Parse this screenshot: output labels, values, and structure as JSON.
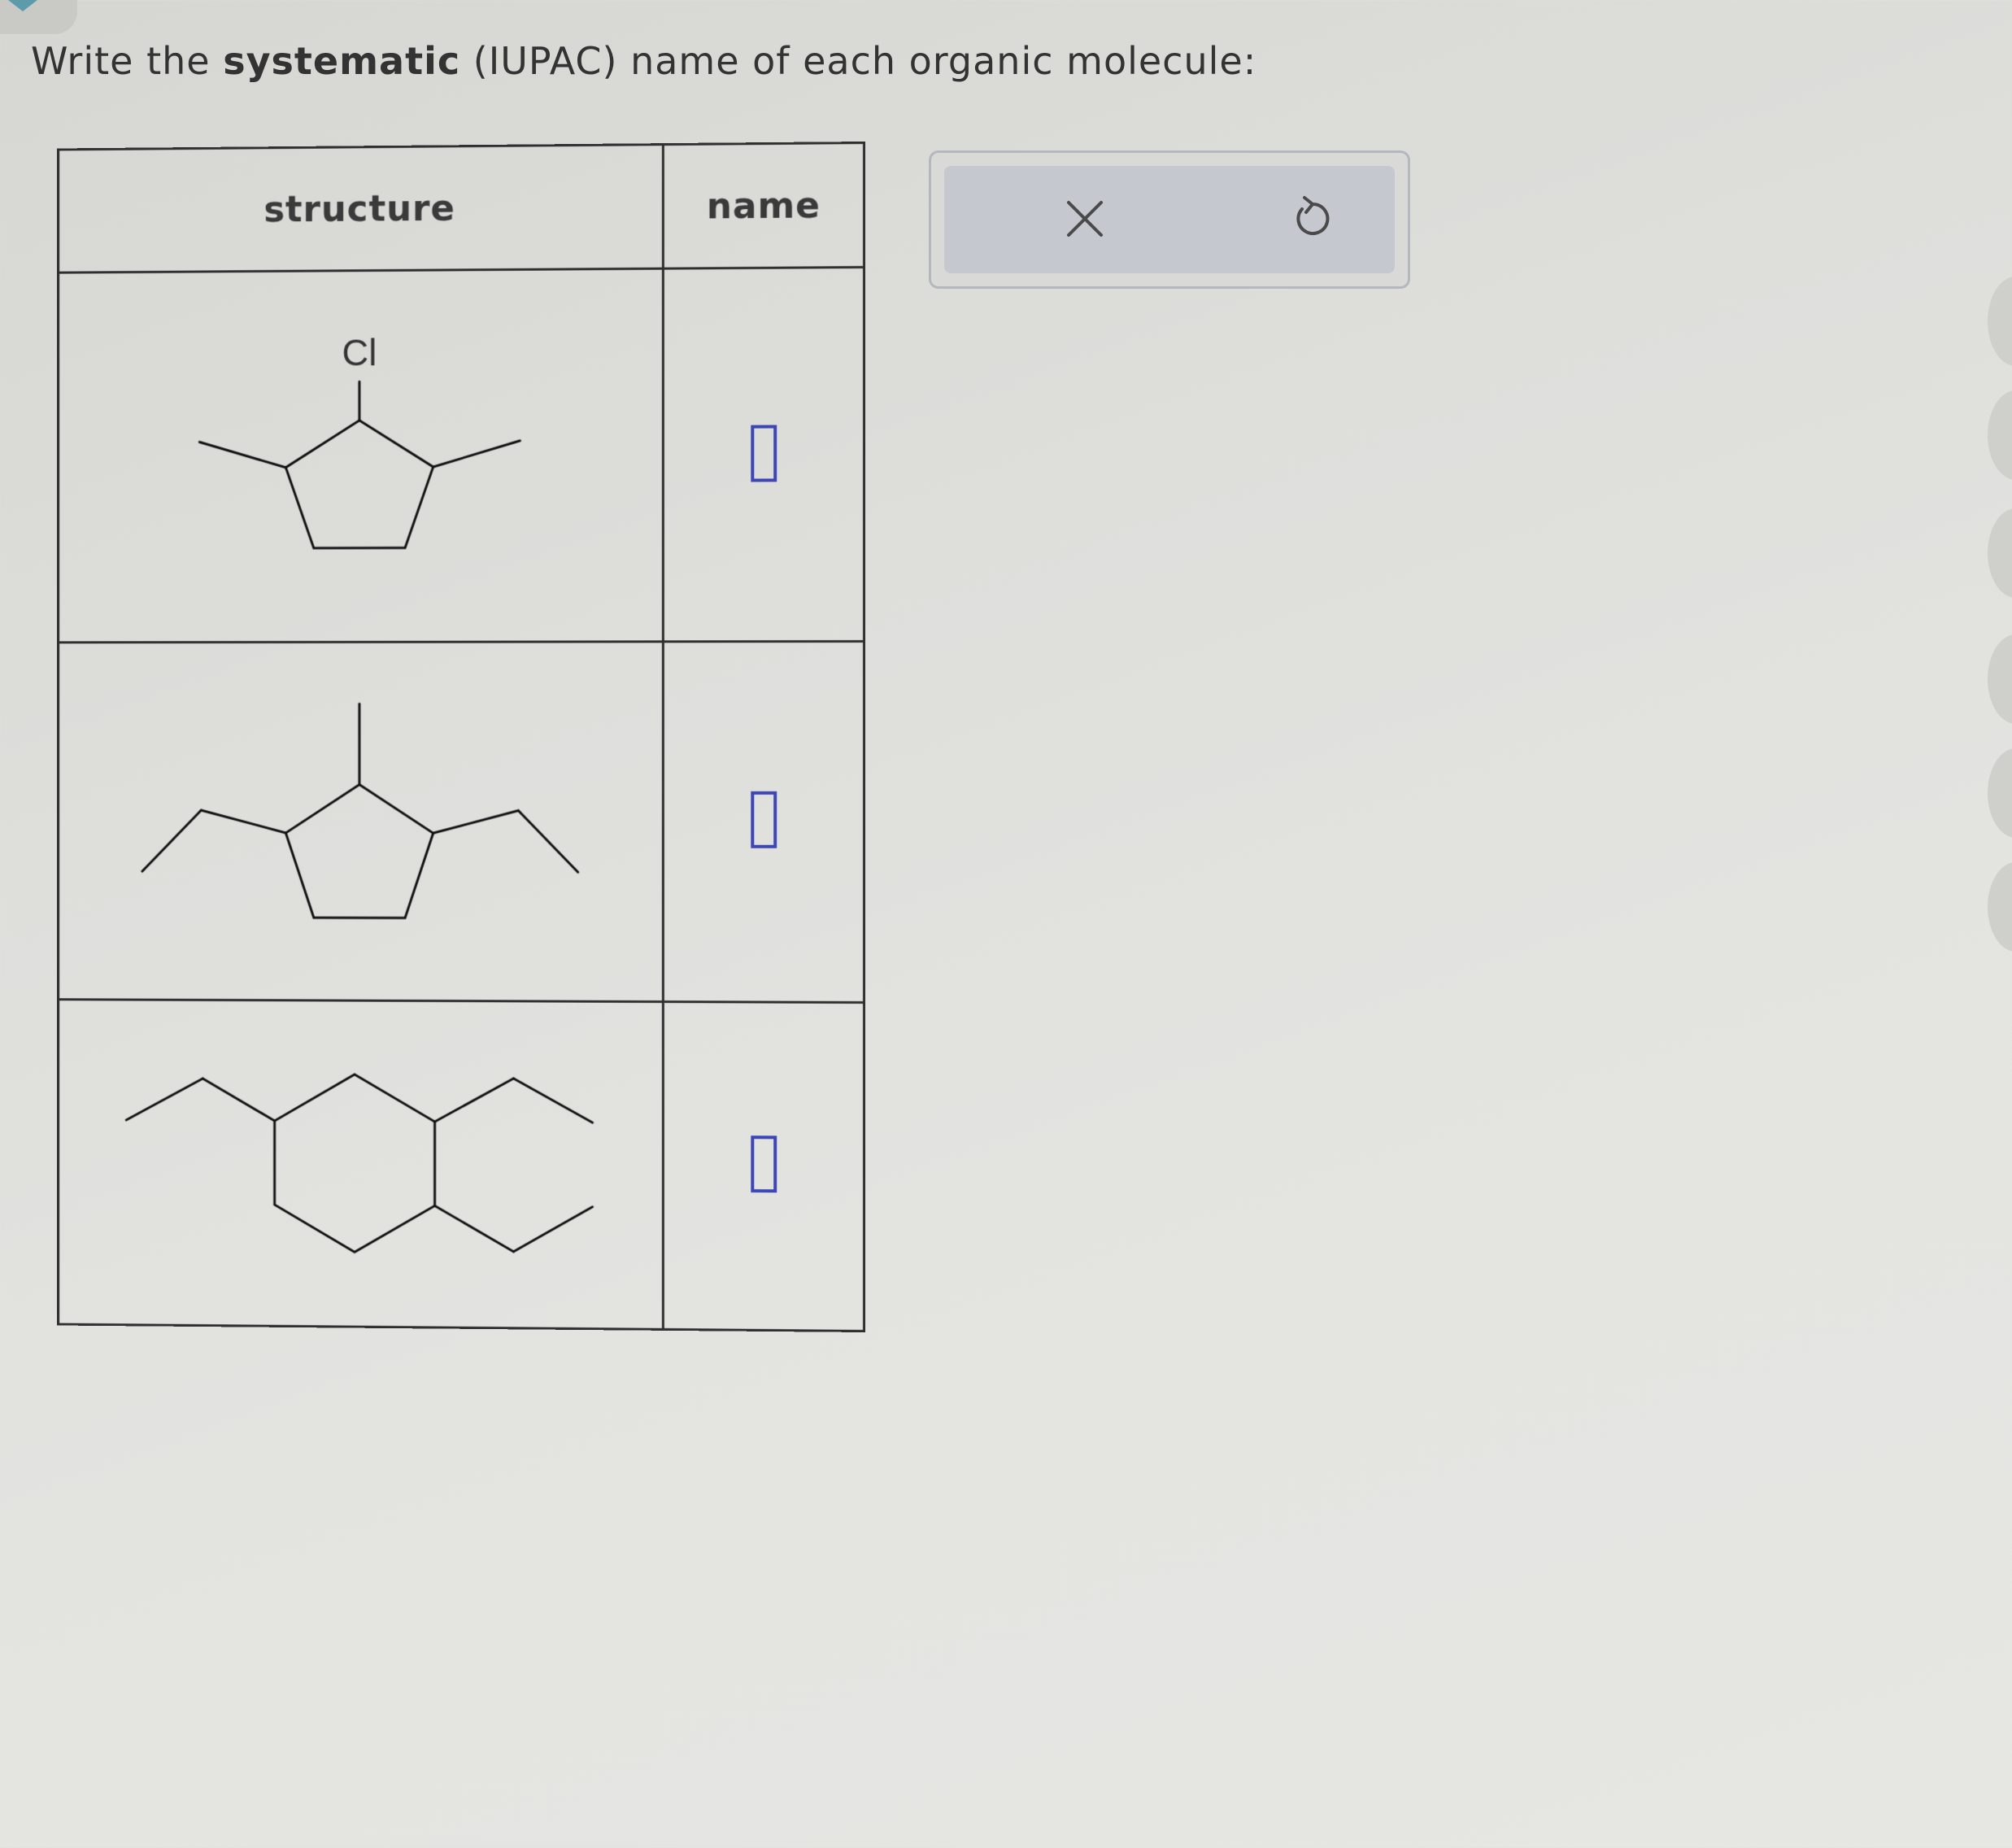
{
  "prompt": {
    "before": "Write the",
    "bold": "systematic",
    "after": "(IUPAC) name of each organic molecule:"
  },
  "table": {
    "headers": [
      "structure",
      "name"
    ],
    "rows": [
      {
        "structure_label": "Cl",
        "name_value": ""
      },
      {
        "structure_label": "",
        "name_value": ""
      },
      {
        "structure_label": "",
        "name_value": ""
      }
    ]
  },
  "toolbar": {
    "buttons": [
      {
        "icon": "close-icon",
        "glyph": "✕"
      },
      {
        "icon": "undo-icon",
        "glyph": "↺"
      }
    ]
  },
  "colors": {
    "answer_box_border": "#3c46b4",
    "toolbar_bg": "#c5c9cf",
    "table_border": "#2f2f2f"
  }
}
